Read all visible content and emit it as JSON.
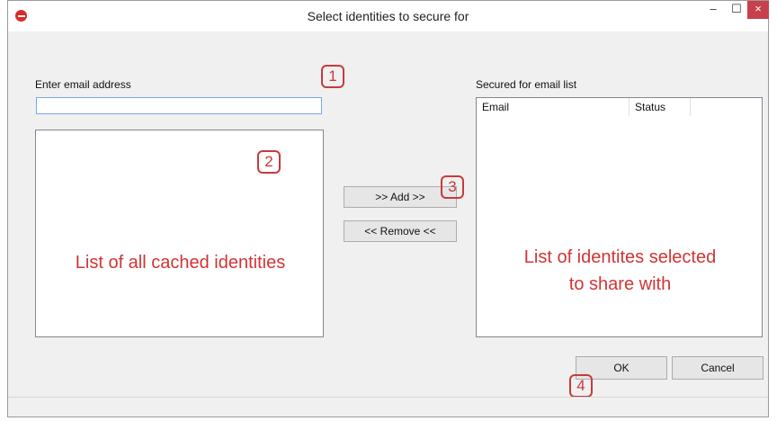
{
  "window": {
    "title": "Select identities to secure for",
    "minimize_glyph": "–",
    "maximize_glyph": "☐",
    "close_glyph": "×"
  },
  "left": {
    "email_label": "Enter email address",
    "email_value": "",
    "list_caption": "List of all cached identities"
  },
  "middle": {
    "add_label": ">> Add >>",
    "remove_label": "<< Remove <<"
  },
  "right": {
    "label": "Secured for email list",
    "columns": [
      "Email",
      "Status"
    ],
    "list_caption_line1": "List of identites selected",
    "list_caption_line2": "to share with"
  },
  "footer": {
    "ok_label": "OK",
    "cancel_label": "Cancel"
  },
  "callouts": [
    "1",
    "2",
    "3",
    "4"
  ],
  "colors": {
    "callout": "#c83a3a",
    "caption": "#d23434",
    "close_button": "#c7404d",
    "input_border": "#7aa7e6"
  },
  "icons": [
    "key-app-icon"
  ]
}
